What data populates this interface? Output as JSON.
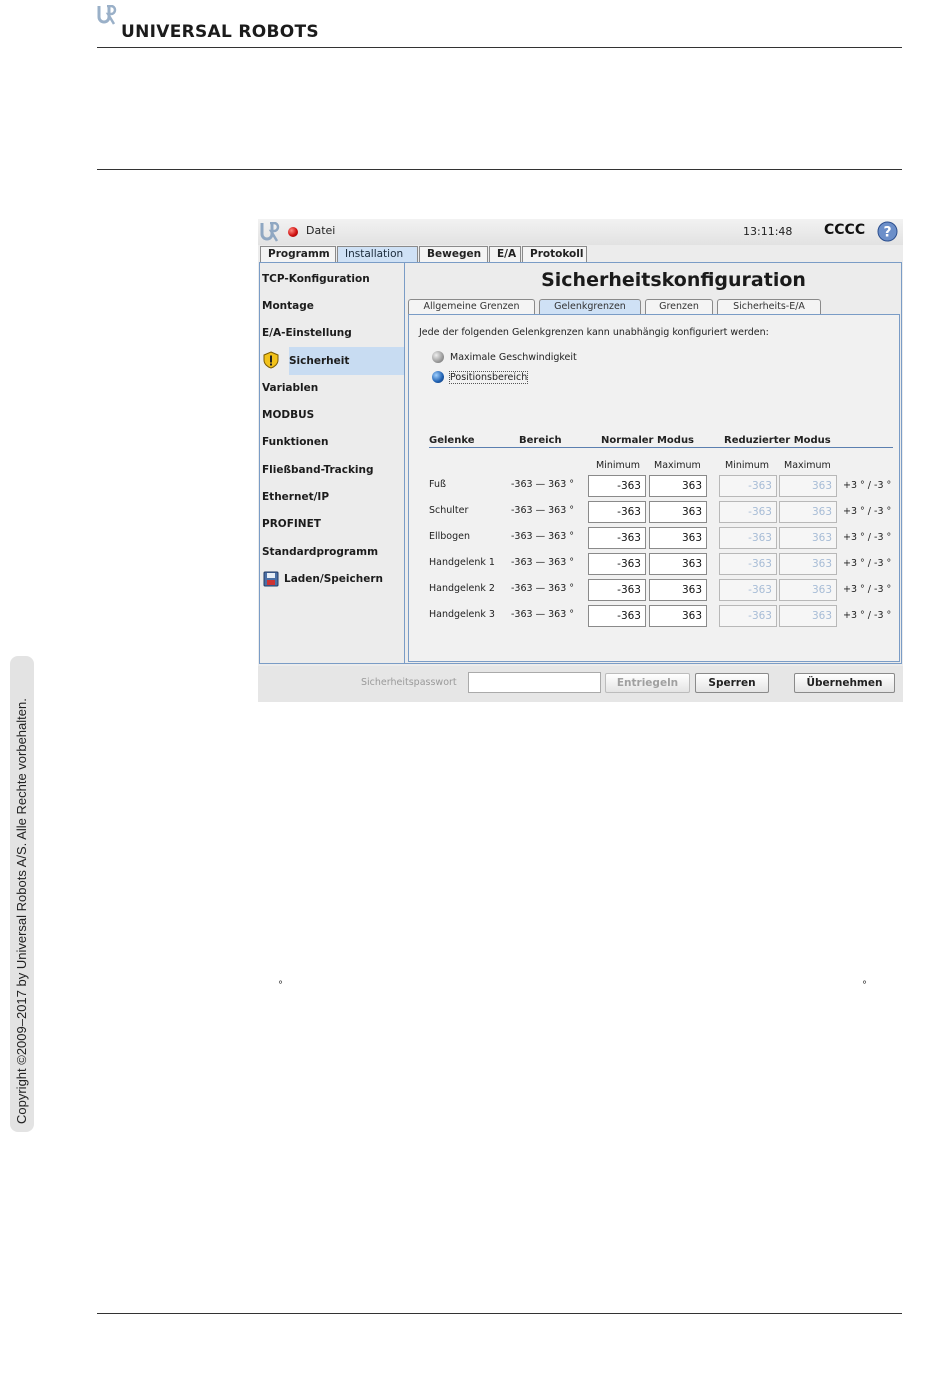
{
  "page": {
    "brand": "UNIVERSAL ROBOTS",
    "copyright": "Copyright ©2009–2017 by Universal Robots A/S. Alle Rechte vorbehalten.",
    "degree_marks": [
      "°",
      "°"
    ]
  },
  "topbar": {
    "file_label": "Datei",
    "time": "13:11:48",
    "robot_name": "CCCC"
  },
  "main_tabs": [
    "Programm",
    "Installation",
    "Bewegen",
    "E/A",
    "Protokoll"
  ],
  "sidebar": {
    "items": [
      "TCP-Konfiguration",
      "Montage",
      "E/A-Einstellung",
      "Sicherheit",
      "Variablen",
      "MODBUS",
      "Funktionen",
      "Fließband-Tracking",
      "Ethernet/IP",
      "PROFINET",
      "Standardprogramm",
      "Laden/Speichern"
    ]
  },
  "panel": {
    "title": "Sicherheitskonfiguration",
    "sub_tabs": [
      "Allgemeine Grenzen",
      "Gelenkgrenzen",
      "Grenzen",
      "Sicherheits-E/A"
    ],
    "intro": "Jede der folgenden Gelenkgrenzen kann unabhängig konfiguriert werden:",
    "radio_options": [
      "Maximale Geschwindigkeit",
      "Positionsbereich"
    ],
    "selected_option": "Positionsbereich",
    "table": {
      "headers": {
        "joints": "Gelenke",
        "range": "Bereich",
        "normal": "Normaler Modus",
        "reduced": "Reduzierter Modus"
      },
      "subheaders": {
        "normal_min": "Minimum",
        "normal_max": "Maximum",
        "reduced_min": "Minimum",
        "reduced_max": "Maximum"
      },
      "rows": [
        {
          "name": "Fuß",
          "range": "-363 — 363 °",
          "n_min": "-363",
          "n_max": "363",
          "r_min": "-363",
          "r_max": "363",
          "tol": "+3 ° / -3 °"
        },
        {
          "name": "Schulter",
          "range": "-363 — 363 °",
          "n_min": "-363",
          "n_max": "363",
          "r_min": "-363",
          "r_max": "363",
          "tol": "+3 ° / -3 °"
        },
        {
          "name": "Ellbogen",
          "range": "-363 — 363 °",
          "n_min": "-363",
          "n_max": "363",
          "r_min": "-363",
          "r_max": "363",
          "tol": "+3 ° / -3 °"
        },
        {
          "name": "Handgelenk 1",
          "range": "-363 — 363 °",
          "n_min": "-363",
          "n_max": "363",
          "r_min": "-363",
          "r_max": "363",
          "tol": "+3 ° / -3 °"
        },
        {
          "name": "Handgelenk 2",
          "range": "-363 — 363 °",
          "n_min": "-363",
          "n_max": "363",
          "r_min": "-363",
          "r_max": "363",
          "tol": "+3 ° / -3 °"
        },
        {
          "name": "Handgelenk 3",
          "range": "-363 — 363 °",
          "n_min": "-363",
          "n_max": "363",
          "r_min": "-363",
          "r_max": "363",
          "tol": "+3 ° / -3 °"
        }
      ]
    }
  },
  "bottombar": {
    "password_label": "Sicherheitspasswort",
    "unlock": "Entriegeln",
    "lock": "Sperren",
    "apply": "Übernehmen"
  },
  "colors": {
    "accent": "#7a9cc6",
    "selected": "#c8dcf2",
    "disabled_text": "#a7bcd6"
  }
}
